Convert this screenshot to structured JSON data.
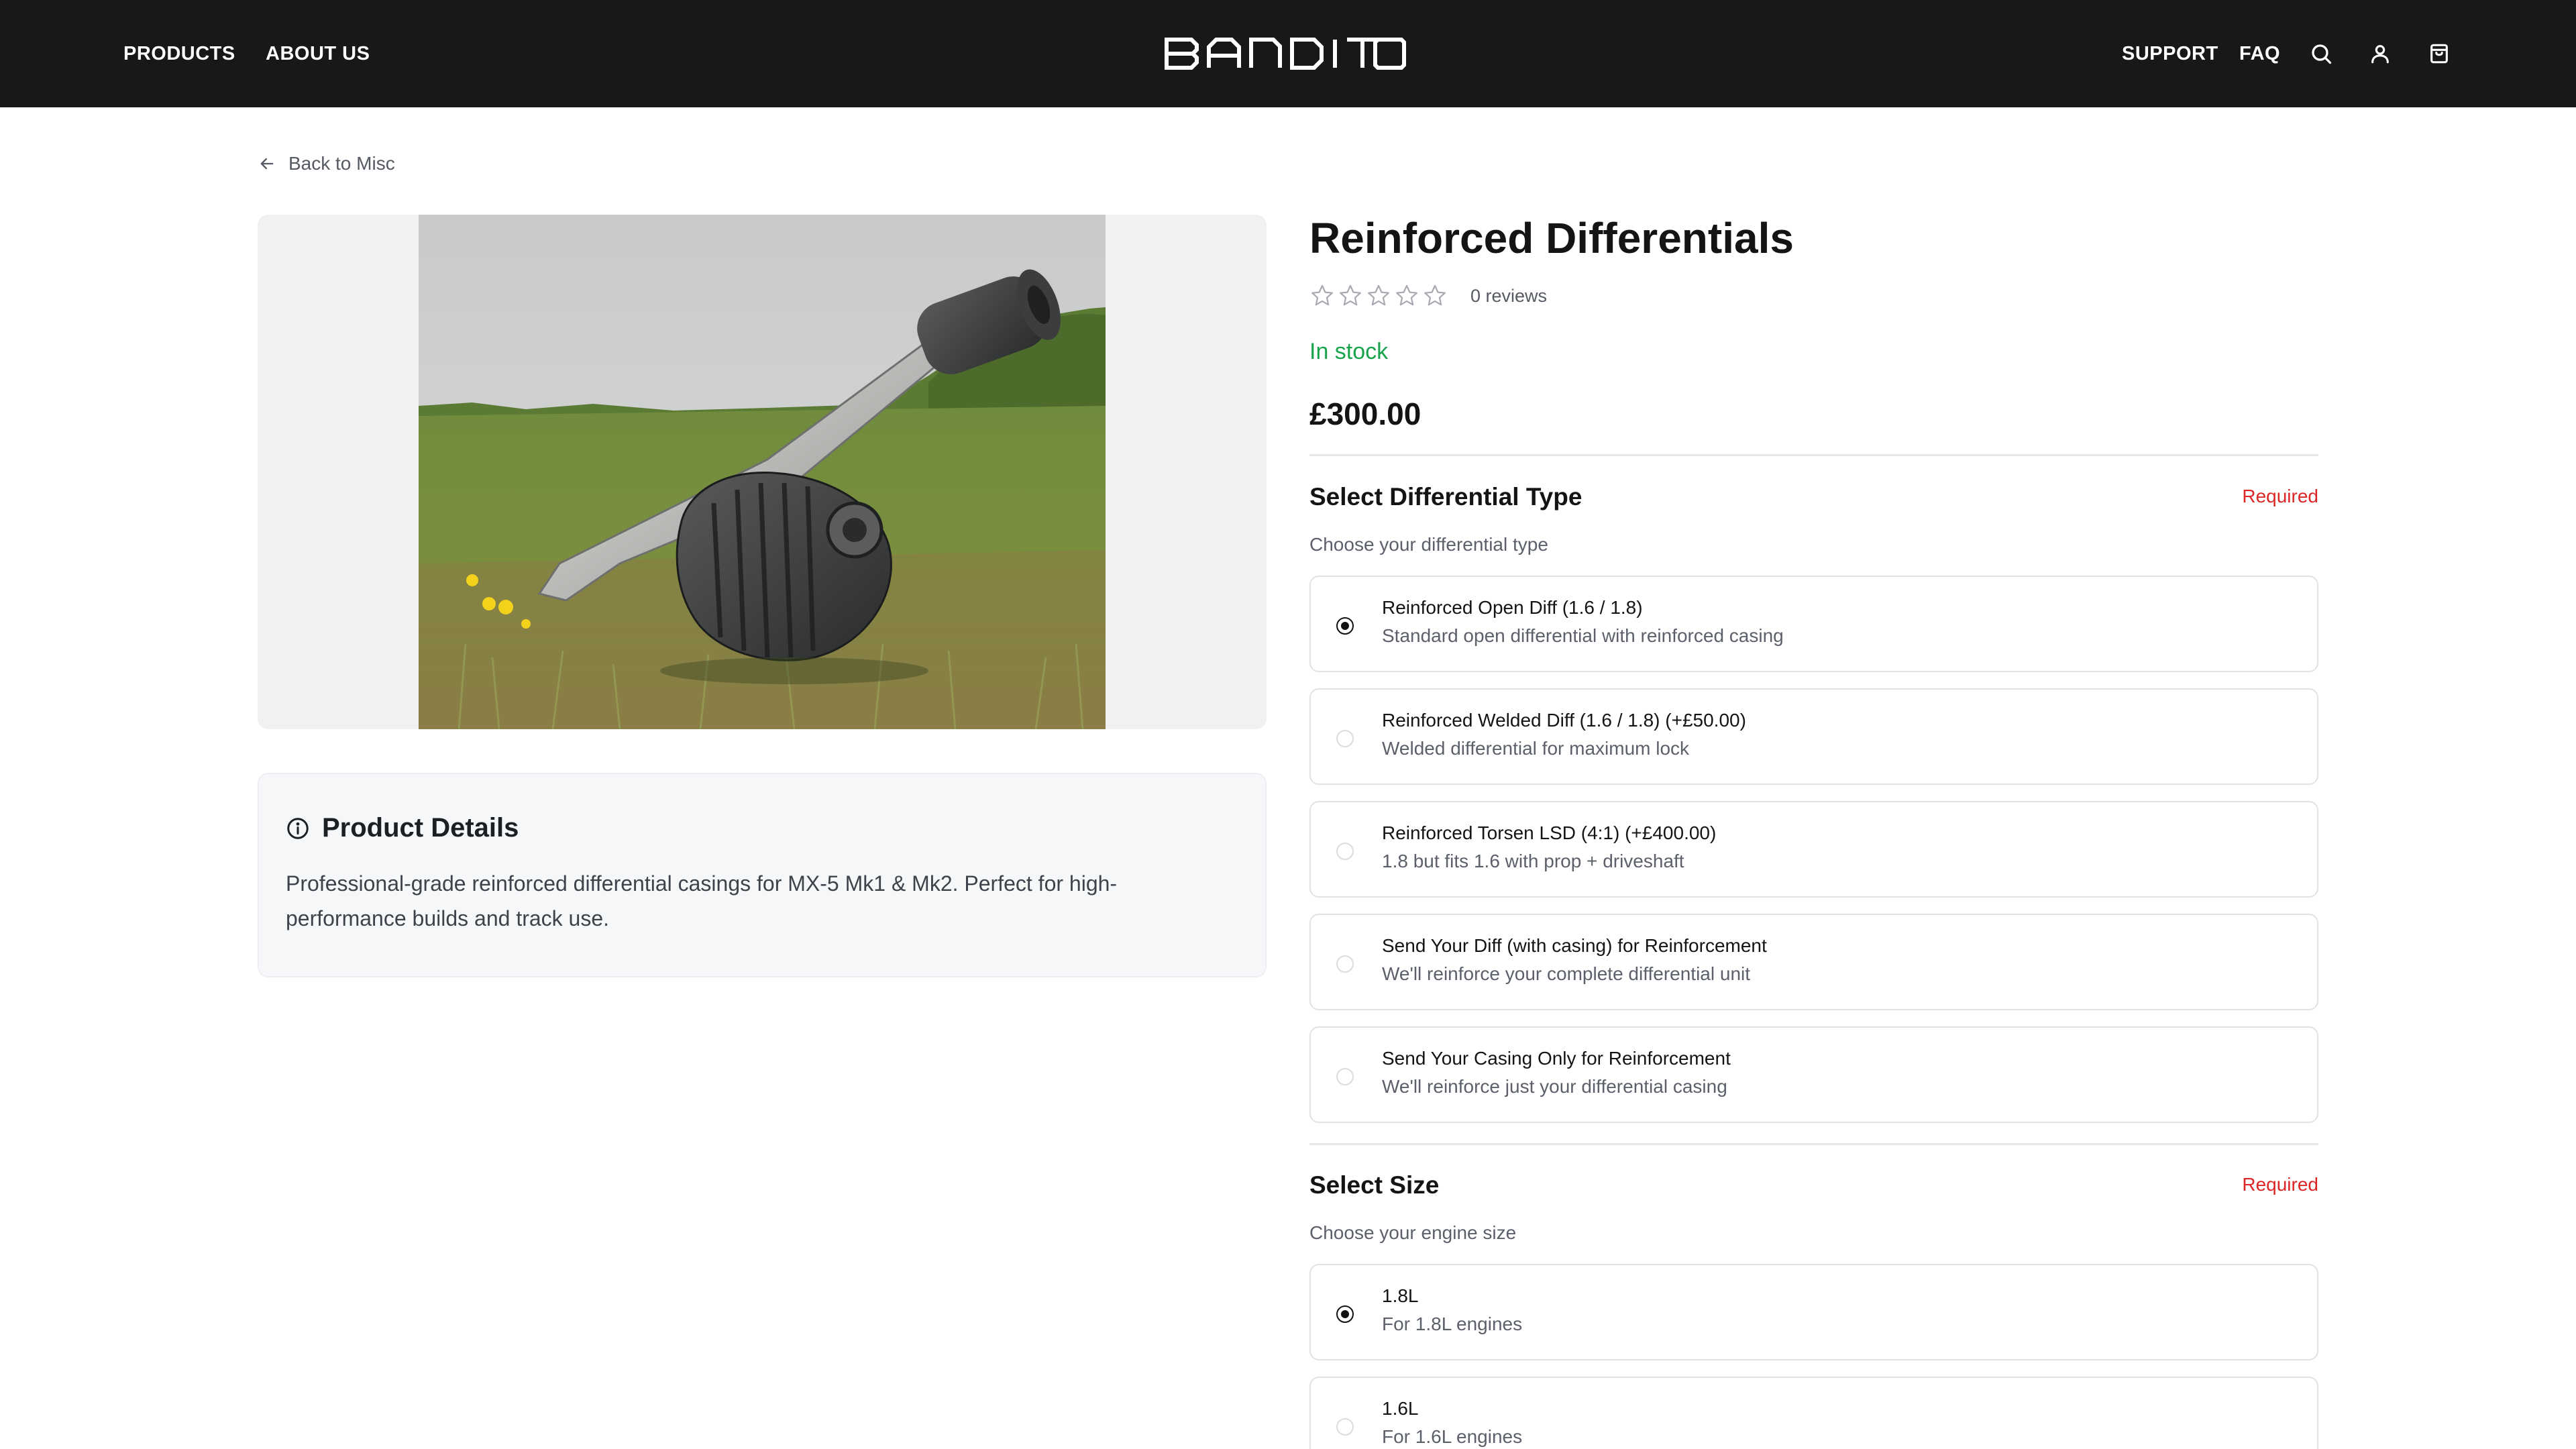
{
  "header": {
    "nav_left": [
      "PRODUCTS",
      "ABOUT US"
    ],
    "logo": "BANDITO",
    "nav_right": [
      "SUPPORT",
      "FAQ"
    ],
    "icons": [
      "search-icon",
      "account-icon",
      "cart-icon"
    ],
    "background": "#18181a"
  },
  "back_link": {
    "label": "Back to Misc"
  },
  "gallery": {
    "image_subject": "reinforced differential casing on grass field"
  },
  "details": {
    "title": "Product Details",
    "text": "Professional-grade reinforced differential casings for MX-5 Mk1 & Mk2. Perfect for high-performance builds and track use."
  },
  "product": {
    "title": "Reinforced Differentials",
    "rating": 0,
    "reviews": "0 reviews",
    "stock": "In stock",
    "price": "£300.00"
  },
  "diff_type": {
    "title": "Select Differential Type",
    "required": "Required",
    "subtitle": "Choose your differential type",
    "options": [
      {
        "label": "Reinforced Open Diff (1.6 / 1.8)",
        "desc": "Standard open differential with reinforced casing",
        "selected": true
      },
      {
        "label": "Reinforced Welded Diff (1.6 / 1.8) (+£50.00)",
        "desc": "Welded differential for maximum lock",
        "selected": false
      },
      {
        "label": "Reinforced Torsen LSD (4:1) (+£400.00)",
        "desc": "1.8 but fits 1.6 with prop + driveshaft",
        "selected": false
      },
      {
        "label": "Send Your Diff (with casing) for Reinforcement",
        "desc": "We'll reinforce your complete differential unit",
        "selected": false
      },
      {
        "label": "Send Your Casing Only for Reinforcement",
        "desc": "We'll reinforce just your differential casing",
        "selected": false
      }
    ]
  },
  "size": {
    "title": "Select Size",
    "required": "Required",
    "subtitle": "Choose your engine size",
    "options": [
      {
        "label": "1.8L",
        "desc": "For 1.8L engines",
        "selected": true
      },
      {
        "label": "1.6L",
        "desc": "For 1.6L engines",
        "selected": false
      }
    ]
  },
  "colors": {
    "in_stock": "#16a34a",
    "required": "#dc2626"
  }
}
